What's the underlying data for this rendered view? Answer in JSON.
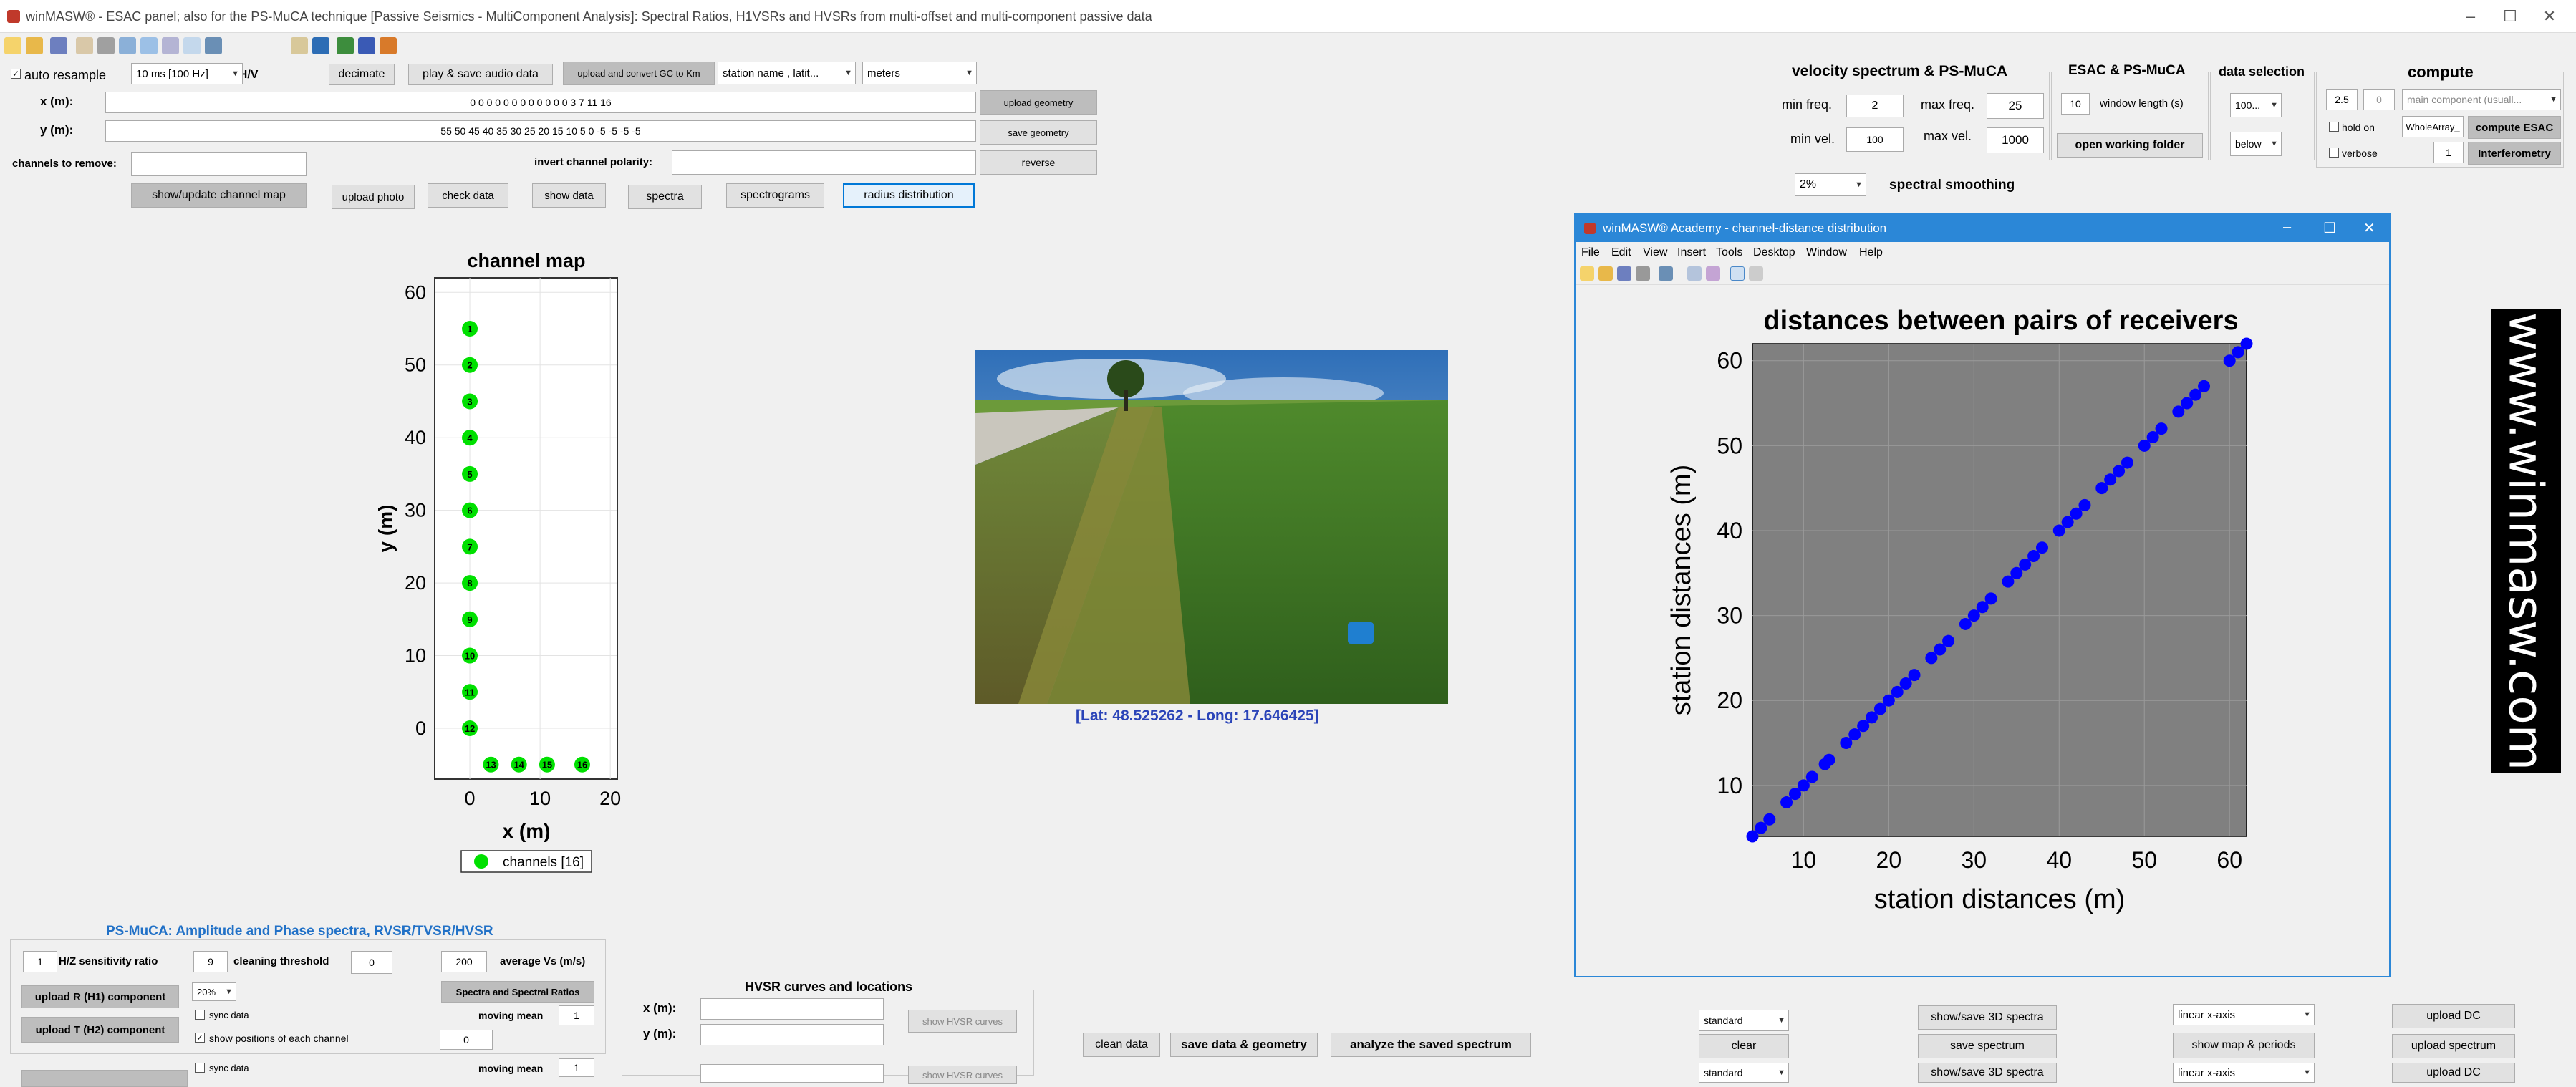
{
  "window": {
    "title": "winMASW® - ESAC panel; also for the PS-MuCA technique [Passive Seismics - MultiComponent Analysis]: Spectral Ratios, H1VSRs and HVSRs from multi-offset and multi-component passive data",
    "minimize": "–",
    "maximize": "☐",
    "close": "✕"
  },
  "toolbar": {
    "hv_label": "H/V"
  },
  "top": {
    "auto_resample": "auto resample",
    "sampling": "10 ms [100 Hz]",
    "decimate": "decimate",
    "play_save": "play & save audio data",
    "upload_convert": "upload and convert GC to Km",
    "station_name": "station name , latit...",
    "units": "meters",
    "x_label": "x (m):",
    "x_value": "0 0 0 0  0 0 0 0 0 0 0 0 3 7 11 16",
    "y_label": "y (m):",
    "y_value": "55 50 45 40 35 30 25 20 15 10 5 0 -5 -5 -5 -5",
    "upload_geometry": "upload geometry",
    "save_geometry": "save geometry",
    "reverse": "reverse",
    "channels_remove": "channels to remove:",
    "invert_polarity": "invert channel polarity:"
  },
  "buttons": {
    "show_update_map": "show/update channel map",
    "upload_photo": "upload photo",
    "check_data": "check data",
    "show_data": "show data",
    "spectra": "spectra",
    "spectrograms": "spectrograms",
    "radius_distribution": "radius distribution"
  },
  "velocity": {
    "title": "velocity spectrum & PS-MuCA",
    "min_freq_label": "min freq.",
    "min_freq": "2",
    "max_freq_label": "max freq.",
    "max_freq": "25",
    "min_vel_label": "min vel.",
    "min_vel": "100",
    "max_vel_label": "max vel.",
    "max_vel": "1000"
  },
  "esac": {
    "title": "ESAC & PS-MuCA",
    "window": "10",
    "window_label": "window length (s)",
    "open_folder": "open working folder"
  },
  "datasel": {
    "title": "data selection",
    "value": "100...",
    "below": "below"
  },
  "compute": {
    "title": "compute",
    "v1": "2.5",
    "v2": "0",
    "component": "main component (usuall...",
    "hold_on": "hold on",
    "whole_array": "WholeArray_",
    "compute_esac": "compute ESAC",
    "verbose": "verbose",
    "verbose_val": "1",
    "interferometry": "Interferometry"
  },
  "smoothing": {
    "value": "2%",
    "label": "spectral smoothing"
  },
  "channel_map": {
    "title": "channel map",
    "xlabel": "x (m)",
    "ylabel": "y (m)",
    "legend": "channels [16]",
    "yticks": [
      "60",
      "50",
      "40",
      "30",
      "20",
      "10",
      "0"
    ],
    "xticks": [
      "0",
      "10",
      "20"
    ]
  },
  "photo": {
    "caption": "[Lat: 48.525262 - Long: 17.646425]"
  },
  "figure": {
    "title": "winMASW® Academy - channel-distance distribution",
    "menu": [
      "File",
      "Edit",
      "View",
      "Insert",
      "Tools",
      "Desktop",
      "Window",
      "Help"
    ],
    "minimize": "–",
    "maximize": "☐",
    "close": "✕"
  },
  "chart_data": {
    "type": "scatter",
    "title": "distances between pairs of receivers",
    "xlabel": "station distances (m)",
    "ylabel": "station distances (m)",
    "xlim": [
      4,
      62
    ],
    "ylim": [
      4,
      62
    ],
    "xticks": [
      10,
      20,
      30,
      40,
      50,
      60
    ],
    "yticks": [
      10,
      20,
      30,
      40,
      50,
      60
    ],
    "grid": true,
    "color": "#0000ff",
    "background": "#808080",
    "x": [
      4,
      5,
      6,
      8,
      9,
      10,
      11,
      12.5,
      13,
      15,
      16,
      17,
      18,
      19,
      20,
      21,
      22,
      23,
      25,
      26,
      27,
      29,
      30,
      31,
      32,
      34,
      35,
      36,
      37,
      38,
      40,
      41,
      42,
      43,
      45,
      46,
      47,
      48,
      50,
      51,
      52,
      54,
      55,
      56,
      57,
      60,
      61,
      62
    ],
    "y": [
      4,
      5,
      6,
      8,
      9,
      10,
      11,
      12.5,
      13,
      15,
      16,
      17,
      18,
      19,
      20,
      21,
      22,
      23,
      25,
      26,
      27,
      29,
      30,
      31,
      32,
      34,
      35,
      36,
      37,
      38,
      40,
      41,
      42,
      43,
      45,
      46,
      47,
      48,
      50,
      51,
      52,
      54,
      55,
      56,
      57,
      60,
      61,
      62
    ]
  },
  "logo": {
    "text": "www.winmasw.com"
  },
  "psmuca": {
    "title": "PS-MuCA: Amplitude and Phase spectra, RVSR/TVSR/HVSR",
    "hz_val": "1",
    "hz_label": "H/Z sensitivity ratio",
    "clean_val": "9",
    "clean_label": "cleaning threshold",
    "zero_val": "0",
    "vs_val": "200",
    "vs_label": "average Vs (m/s)",
    "upload_r": "upload R (H1) component",
    "pct": "20%",
    "spectra_ratios": "Spectra and Spectral Ratios",
    "moving_mean": "moving mean",
    "mm_val": "1",
    "sync": "sync data",
    "upload_t": "upload T (H2) component",
    "show_positions": "show positions of each channel",
    "zero2": "0"
  },
  "hvsr": {
    "title": "HVSR curves and locations",
    "x_label": "x (m):",
    "y_label": "y (m):",
    "show_curves": "show HVSR curves"
  },
  "bottom": {
    "clean_data": "clean data",
    "save_data": "save data & geometry",
    "analyze": "analyze the saved spectrum",
    "standard": "standard",
    "clear": "clear",
    "show_3d": "show/save 3D spectra",
    "save_spectrum": "save spectrum",
    "linear": "linear x-axis",
    "show_map": "show map & periods",
    "upload_dc": "upload DC",
    "upload_spectrum": "upload spectrum"
  }
}
